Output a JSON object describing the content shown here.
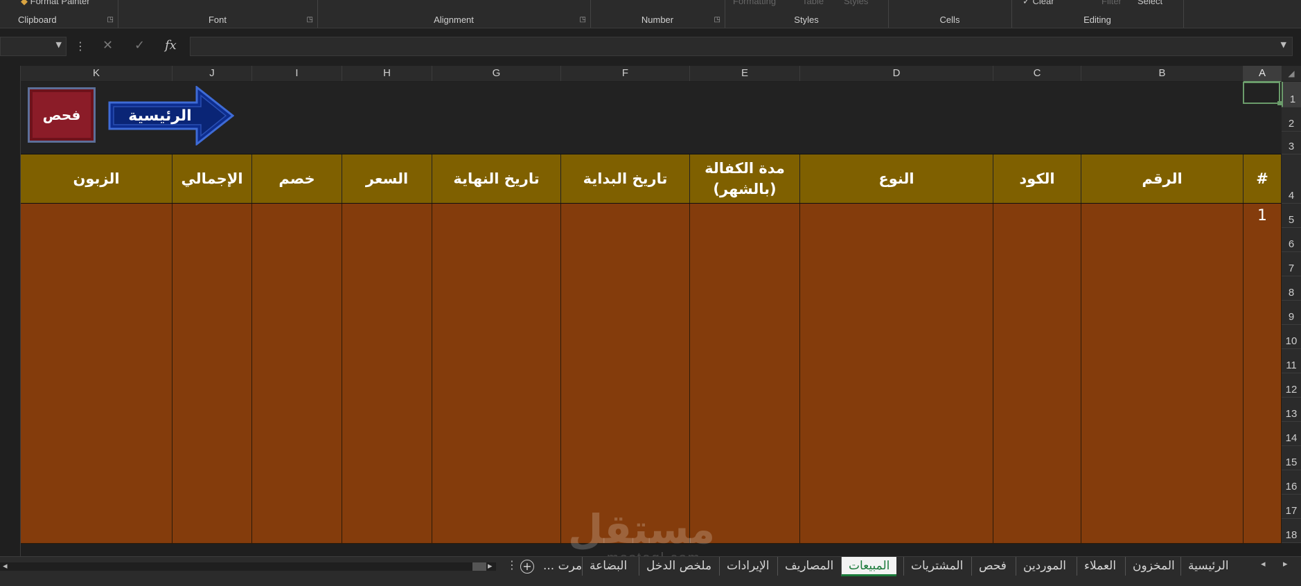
{
  "ribbon": {
    "top_cut": [
      "Format Painter",
      "Formatting",
      "Table",
      "Styles",
      "Clear",
      "Filter",
      "Select"
    ],
    "groups": [
      "Clipboard",
      "Font",
      "Alignment",
      "Number",
      "Styles",
      "Cells",
      "Editing"
    ]
  },
  "formula_bar": {
    "fx": "fx",
    "cancel": "✕",
    "enter": "✓",
    "sep": "⋮",
    "name_value": "",
    "formula_value": ""
  },
  "columns": [
    "K",
    "J",
    "I",
    "H",
    "G",
    "F",
    "E",
    "D",
    "C",
    "B",
    "A"
  ],
  "rows": [
    "1",
    "2",
    "3",
    "4",
    "5",
    "6",
    "7",
    "8",
    "9",
    "10",
    "11",
    "12",
    "13",
    "14",
    "15",
    "16",
    "17",
    "18"
  ],
  "buttons": {
    "check": "فحص",
    "home": "الرئيسية"
  },
  "table": {
    "headers": [
      "الزبون",
      "الإجمالي",
      "خصم",
      "السعر",
      "تاريخ النهاية",
      "تاريخ البداية",
      "مدة الكفالة (بالشهر)",
      "النوع",
      "الكود",
      "الرقم",
      "#"
    ],
    "first_row_number": "1",
    "header_color": "#7f6000",
    "body_color": "#843c0c"
  },
  "watermark": {
    "text": "مستقل",
    "sub": "mostaql.com"
  },
  "sheet_tabs": [
    "الرئيسية",
    "المخزون",
    "العملاء",
    "الموردين",
    "فحص",
    "المشتريات",
    "المبيعات",
    "المصاريف",
    "الإيرادات",
    "ملخص الدخل",
    "البضاعة",
    "مرت ..."
  ],
  "active_tab": "المبيعات",
  "colors": {
    "accent": "#1a7a3a",
    "selection": "#6b9c6b",
    "ribbon_bg": "#2b2b2b"
  }
}
